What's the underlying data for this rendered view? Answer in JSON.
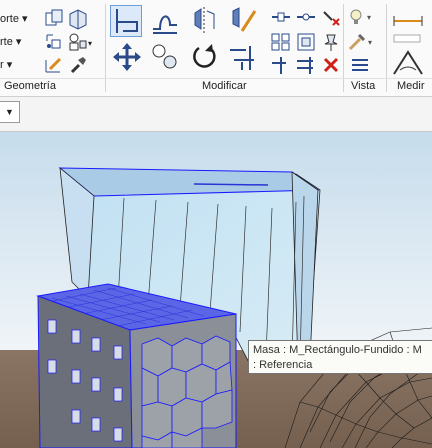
{
  "ribbon": {
    "geometry": {
      "label": "Geometría",
      "cut_label": "orte",
      "join_label": "rte",
      "third_label": "r"
    },
    "modify": {
      "label": "Modificar"
    },
    "view": {
      "label": "Vista"
    },
    "measure": {
      "label": "Medir"
    }
  },
  "colors": {
    "ribbon_bg": "#fafafa",
    "sky_top": "#cfe1ee",
    "ground": "#8a7464",
    "glass": "#a9cfe6",
    "building_blue": "#2b33d6",
    "selected_edge": "#1a1aff",
    "delete_red": "#d0201a"
  },
  "tooltip": {
    "line1": "Masa : M_Rectángulo-Fundido : M",
    "line2": ": Referencia"
  }
}
